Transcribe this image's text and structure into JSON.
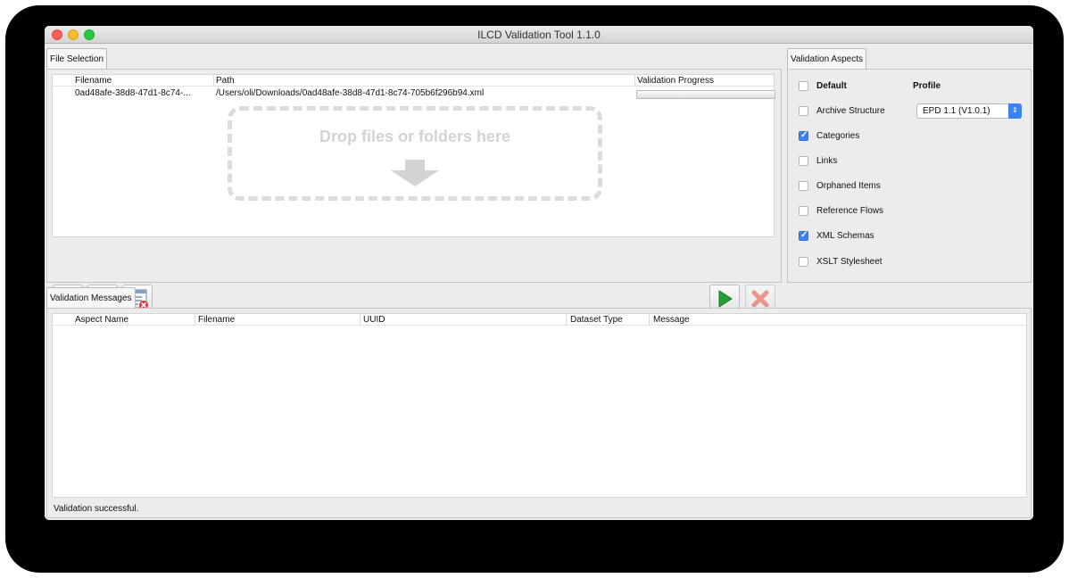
{
  "window": {
    "title": "ILCD Validation Tool 1.1.0"
  },
  "file_selection": {
    "tab_label": "File Selection",
    "columns": [
      "Filename",
      "Path",
      "Validation Progress"
    ],
    "rows": [
      {
        "filename": "0ad48afe-38d8-47d1-8c74-...",
        "path": "/Users/oli/Downloads/0ad48afe-38d8-47d1-8c74-705b6f296b94.xml",
        "progress": 0
      }
    ],
    "dropzone_text": "Drop files or folders here",
    "buttons": {
      "add": "add-icon",
      "remove": "remove-icon",
      "clear": "clear-list-icon",
      "run": "play-icon",
      "cancel": "cancel-icon"
    }
  },
  "aspects": {
    "tab_label": "Validation Aspects",
    "default_label": "Default",
    "profile_label": "Profile",
    "profile_value": "EPD 1.1 (V1.0.1)",
    "items": [
      {
        "label": "Archive Structure",
        "checked": false
      },
      {
        "label": "Categories",
        "checked": true
      },
      {
        "label": "Links",
        "checked": false
      },
      {
        "label": "Orphaned Items",
        "checked": false
      },
      {
        "label": "Reference Flows",
        "checked": false
      },
      {
        "label": "XML Schemas",
        "checked": true
      },
      {
        "label": "XSLT Stylesheet",
        "checked": false
      }
    ]
  },
  "messages": {
    "tab_label": "Validation Messages",
    "columns": [
      "Aspect Name",
      "Filename",
      "UUID",
      "Dataset Type",
      "Message"
    ]
  },
  "status": "Validation successful.",
  "colors": {
    "accent": "#3b82f6",
    "run": "#22a033",
    "cancel": "#e85a4f"
  }
}
